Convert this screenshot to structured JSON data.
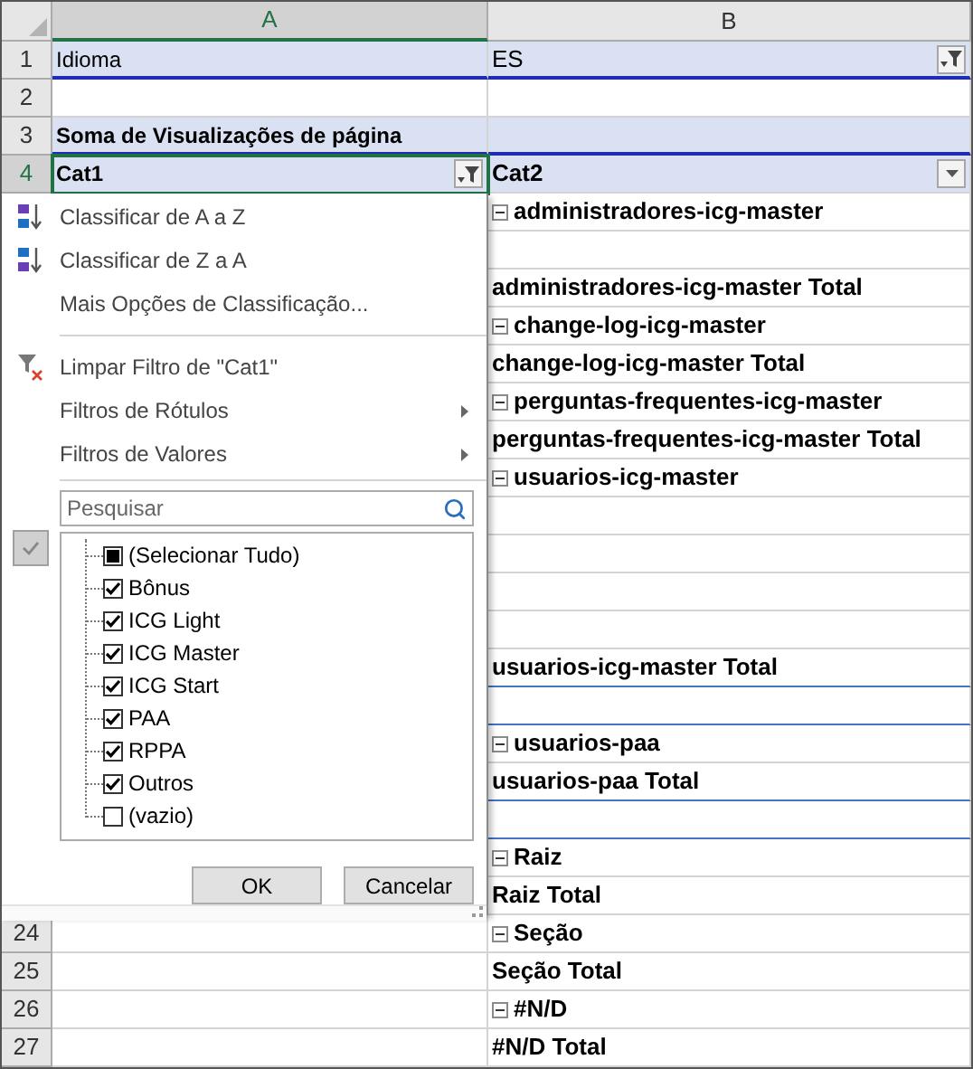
{
  "sheet": {
    "columns": [
      {
        "label": "A",
        "selected": true
      },
      {
        "label": "B",
        "selected": false
      }
    ],
    "rows": [
      {
        "number": "1",
        "selected": false,
        "highlighted": true,
        "rule_below": true,
        "cells": [
          {
            "text": "Idioma",
            "kind": "label"
          },
          {
            "text": "ES",
            "kind": "label",
            "has_filter": true,
            "filtered": true
          }
        ]
      },
      {
        "number": "2",
        "selected": false,
        "cells": [
          {
            "kind": "empty"
          },
          {
            "kind": "empty"
          }
        ]
      },
      {
        "number": "3",
        "selected": false,
        "highlighted": true,
        "rule_below": true,
        "cells": [
          {
            "text": "Soma de Visualizações de página",
            "kind": "title"
          },
          {
            "kind": "empty"
          }
        ]
      },
      {
        "number": "4",
        "selected": true,
        "highlighted": true,
        "cells": [
          {
            "text": "Cat1",
            "kind": "field",
            "has_filter": true,
            "filtered": true,
            "selected": true
          },
          {
            "text": "Cat2",
            "kind": "field",
            "has_filter": true,
            "filtered": false
          }
        ]
      },
      {
        "cells": [
          {
            "text": "administradores-icg-master",
            "kind": "group"
          }
        ]
      },
      {
        "cells": [
          {
            "kind": "empty"
          }
        ]
      },
      {
        "cells": [
          {
            "text": "administradores-icg-master Total",
            "kind": "total"
          }
        ]
      },
      {
        "cells": [
          {
            "text": "change-log-icg-master",
            "kind": "group"
          }
        ]
      },
      {
        "cells": [
          {
            "text": "change-log-icg-master Total",
            "kind": "total"
          }
        ]
      },
      {
        "cells": [
          {
            "text": "perguntas-frequentes-icg-master",
            "kind": "group"
          }
        ]
      },
      {
        "cells": [
          {
            "text": "perguntas-frequentes-icg-master Total",
            "kind": "total"
          }
        ]
      },
      {
        "cells": [
          {
            "text": "usuarios-icg-master",
            "kind": "group"
          }
        ]
      },
      {
        "cells": [
          {
            "kind": "empty"
          }
        ]
      },
      {
        "cells": [
          {
            "kind": "empty"
          }
        ]
      },
      {
        "cells": [
          {
            "kind": "empty"
          }
        ]
      },
      {
        "cells": [
          {
            "kind": "empty"
          }
        ]
      },
      {
        "rule_below": true,
        "cells": [
          {
            "text": "usuarios-icg-master Total",
            "kind": "total"
          }
        ]
      },
      {
        "rule_below": true,
        "cells": [
          {
            "kind": "empty"
          }
        ]
      },
      {
        "cells": [
          {
            "text": "usuarios-paa",
            "kind": "group"
          }
        ]
      },
      {
        "rule_below": true,
        "cells": [
          {
            "text": "usuarios-paa Total",
            "kind": "total"
          }
        ]
      },
      {
        "rule_below": true,
        "cells": [
          {
            "kind": "empty"
          }
        ]
      },
      {
        "cells": [
          {
            "text": "Raiz",
            "kind": "group"
          }
        ]
      },
      {
        "cells": [
          {
            "text": "Raiz Total",
            "kind": "total"
          }
        ]
      },
      {
        "number": "24",
        "selected": false,
        "cells": [
          {
            "kind": "empty"
          },
          {
            "text": "Seção",
            "kind": "group"
          }
        ]
      },
      {
        "number": "25",
        "selected": false,
        "cells": [
          {
            "kind": "empty"
          },
          {
            "text": "Seção Total",
            "kind": "total"
          }
        ]
      },
      {
        "number": "26",
        "selected": false,
        "cells": [
          {
            "kind": "empty"
          },
          {
            "text": "#N/D",
            "kind": "group"
          }
        ]
      },
      {
        "number": "27",
        "selected": false,
        "cells": [
          {
            "kind": "empty"
          },
          {
            "text": "#N/D Total",
            "kind": "total"
          }
        ]
      }
    ]
  },
  "filter_menu": {
    "items": [
      {
        "kind": "sort",
        "label": "Classificar de A a Z",
        "submenu": false
      },
      {
        "kind": "sort",
        "label": "Classificar de Z a A",
        "submenu": false
      },
      {
        "kind": "plain",
        "label": "Mais Opções de Classificação...",
        "submenu": false
      },
      {
        "kind": "separator"
      },
      {
        "kind": "clear",
        "label": "Limpar Filtro de \"Cat1\"",
        "submenu": false
      },
      {
        "kind": "plain",
        "label": "Filtros de Rótulos",
        "submenu": true
      },
      {
        "kind": "plain",
        "label": "Filtros de Valores",
        "submenu": true
      }
    ],
    "search": {
      "placeholder": "Pesquisar"
    },
    "values": [
      {
        "label": "(Selecionar Tudo)",
        "checked": false,
        "indeterminate": true
      },
      {
        "label": "Bônus",
        "checked": true
      },
      {
        "label": "ICG Light",
        "checked": true
      },
      {
        "label": "ICG Master",
        "checked": true
      },
      {
        "label": "ICG Start",
        "checked": true
      },
      {
        "label": "PAA",
        "checked": true
      },
      {
        "label": "RPPA",
        "checked": true
      },
      {
        "label": "Outros",
        "checked": true
      },
      {
        "label": "(vazio)",
        "checked": false
      }
    ],
    "buttons": [
      "OK",
      "Cancelar"
    ]
  }
}
